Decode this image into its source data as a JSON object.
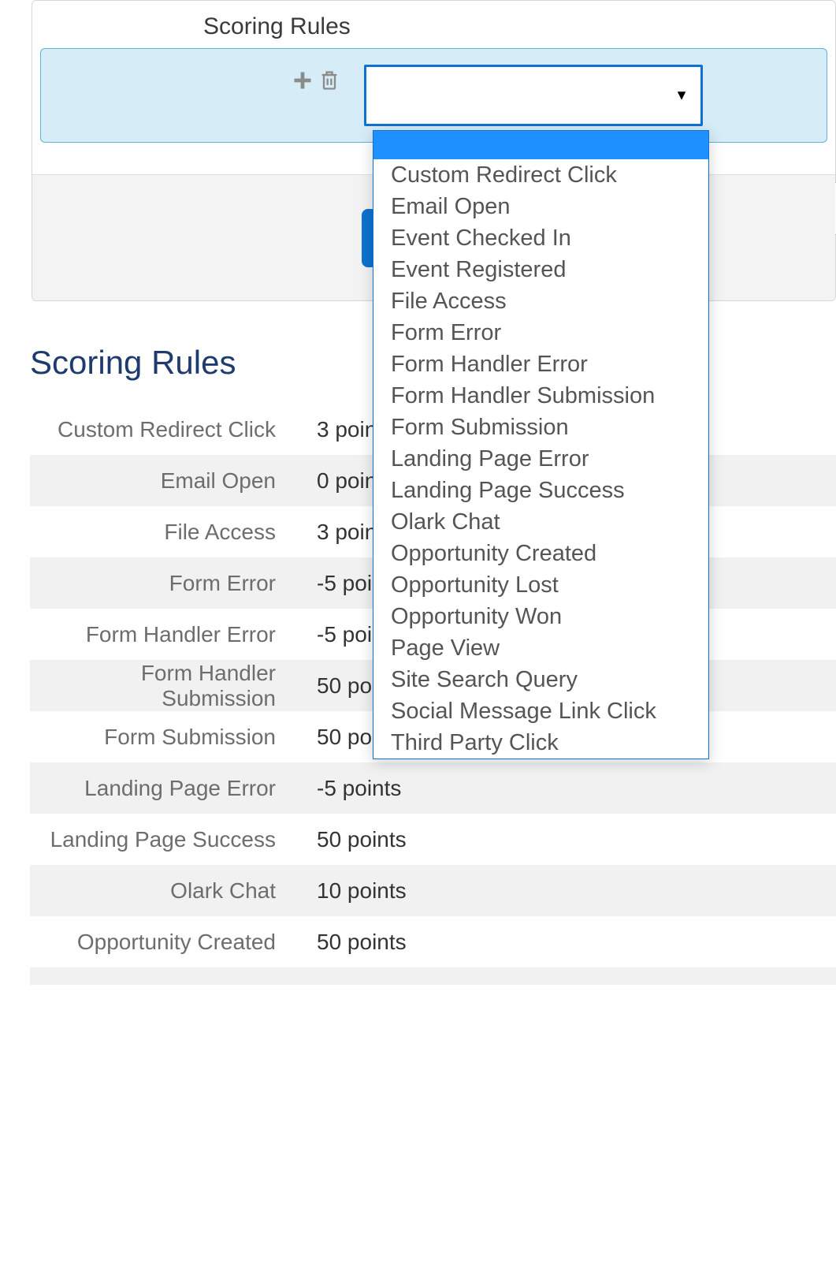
{
  "form": {
    "section_label": "Scoring Rules",
    "select_value": "",
    "dropdown_options": [
      "Custom Redirect Click",
      "Email Open",
      "Event Checked In",
      "Event Registered",
      "File Access",
      "Form Error",
      "Form Handler Error",
      "Form Handler Submission",
      "Form Submission",
      "Landing Page Error",
      "Landing Page Success",
      "Olark Chat",
      "Opportunity Created",
      "Opportunity Lost",
      "Opportunity Won",
      "Page View",
      "Site Search Query",
      "Social Message Link Click",
      "Third Party Click"
    ]
  },
  "page": {
    "heading": "Scoring Rules"
  },
  "rules": [
    {
      "label": "Custom Redirect Click",
      "value": "3 points"
    },
    {
      "label": "Email Open",
      "value": "0 points"
    },
    {
      "label": "File Access",
      "value": "3 points"
    },
    {
      "label": "Form Error",
      "value": "-5 points"
    },
    {
      "label": "Form Handler Error",
      "value": "-5 points"
    },
    {
      "label": "Form Handler Submission",
      "value": "50 points"
    },
    {
      "label": "Form Submission",
      "value": "50 points"
    },
    {
      "label": "Landing Page Error",
      "value": "-5 points"
    },
    {
      "label": "Landing Page Success",
      "value": "50 points"
    },
    {
      "label": "Olark Chat",
      "value": "10 points"
    },
    {
      "label": "Opportunity Created",
      "value": "50 points"
    }
  ]
}
